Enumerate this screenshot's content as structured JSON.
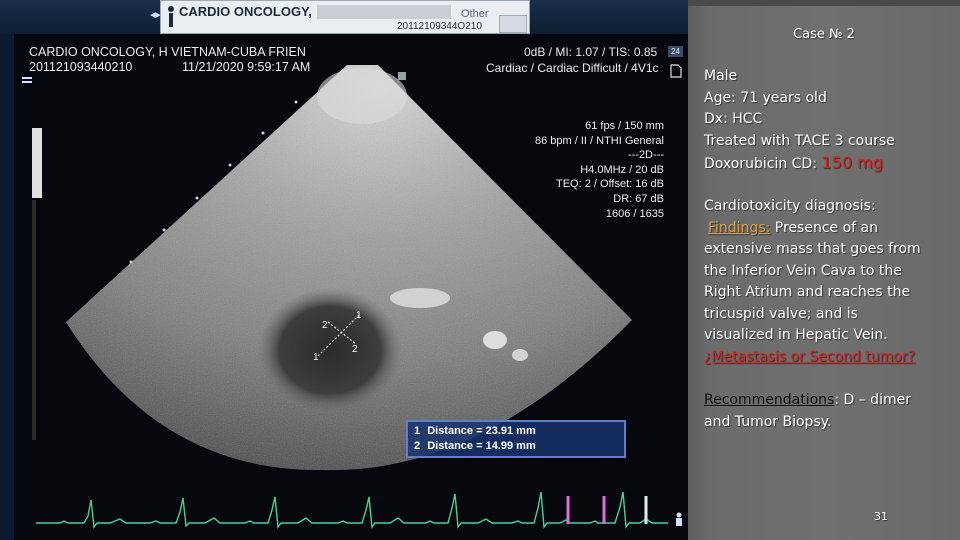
{
  "monitor": {
    "topbar": {
      "header_title": "CARDIO ONCOLOGY,",
      "patient_id": "20112109344O210",
      "exam_type": "Other"
    },
    "info": {
      "institution": "CARDIO ONCOLOGY, H VIETNAM-CUBA FRIEN",
      "patient_id": "201121093440210",
      "datetime": "11/21/2020 9:59:17 AM",
      "power": "0dB / MI: 1.07 / TIS: 0.85",
      "preset": "Cardiac / Cardiac Difficult / 4V1c",
      "side_badge": "24"
    },
    "params": [
      "61 fps / 150 mm",
      "86 bpm / II / NTHI General",
      "---2D---",
      "H4.0MHz / 20 dB",
      "TEQ: 2 / Offset: 16 dB",
      "DR: 67 dB",
      "1606 / 1635"
    ],
    "measure_marks": [
      "1",
      "2",
      "1",
      "2"
    ],
    "distances": [
      {
        "index": "1",
        "label": "Distance = 23.91 mm"
      },
      {
        "index": "2",
        "label": "Distance = 14.99 mm"
      }
    ]
  },
  "case_panel": {
    "title": "Case № 2",
    "lines": [
      "Male",
      "Age: 71 years old",
      "Dx: HCC",
      "Treated with TACE 3 course"
    ],
    "dose_label": "Doxorubicin CD:",
    "dose_value": "150 mg",
    "diag_title": "Cardiotoxicity diagnosis:",
    "findings_label": "Findings:",
    "findings_text_1": " Presence of an",
    "findings_lines": [
      "extensive mass that goes from",
      "the Inferior Vein Cava to the",
      "Right Atrium and reaches the",
      "tricuspid valve; and is",
      "visualized in Hepatic Vein."
    ],
    "question": "¿Metastasis or Second tumor?",
    "rec_label": "Recommendations",
    "rec_text": ": D – dimer",
    "rec_text_2": "and Tumor Biopsy.",
    "page_number": "31"
  },
  "colors": {
    "panel_bg": "#6d6d6d",
    "highlight": "#e0201a",
    "measure_box": "#17326e",
    "ecg": "#41d39b"
  }
}
